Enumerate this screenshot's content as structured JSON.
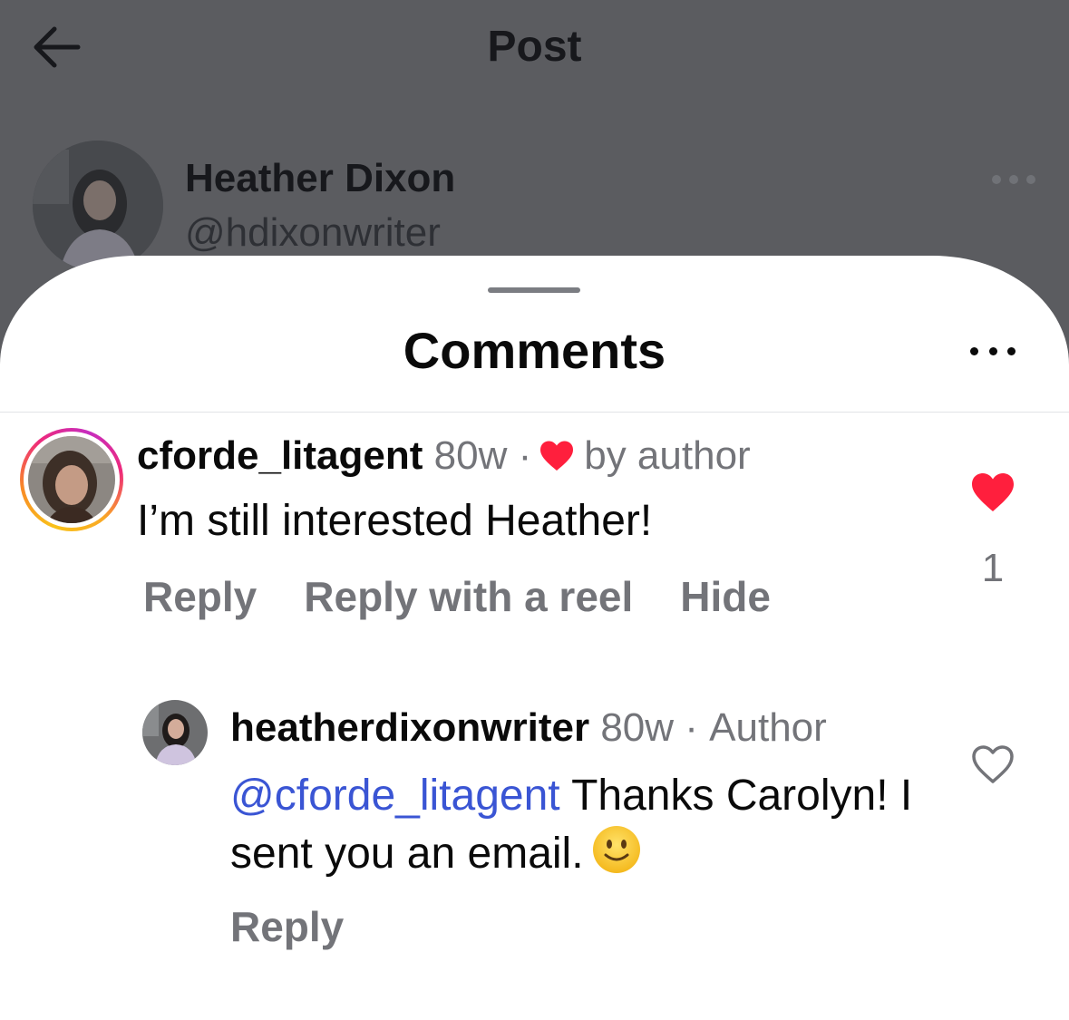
{
  "header": {
    "title": "Post"
  },
  "post": {
    "author_name": "Heather Dixon",
    "author_handle": "@hdixonwriter"
  },
  "sheet": {
    "title": "Comments"
  },
  "comments": [
    {
      "username": "cforde_litagent",
      "age": "80w",
      "separator": "·",
      "liked_by_author_label": "by author",
      "text": "I’m still interested Heather!",
      "actions": [
        "Reply",
        "Reply with a reel",
        "Hide"
      ],
      "like_count": "1",
      "liked": true
    },
    {
      "username": "heatherdixonwriter",
      "age": "80w",
      "separator": "·",
      "badge": "Author",
      "mention": "@cforde_litagent",
      "text": "Thanks Carolyn! I sent you an email.",
      "actions": [
        "Reply"
      ],
      "liked": false
    }
  ],
  "icons": {
    "back": "arrow-left-icon",
    "more": "ellipsis-icon",
    "heart_filled": "heart-filled-icon",
    "heart_outline": "heart-outline-icon",
    "emoji": "slightly-smiling-face-emoji"
  },
  "colors": {
    "like_red": "#ff1f3d",
    "mention_blue": "#3a55d4",
    "secondary_gray": "#737479",
    "backdrop": "#5b5c60"
  }
}
